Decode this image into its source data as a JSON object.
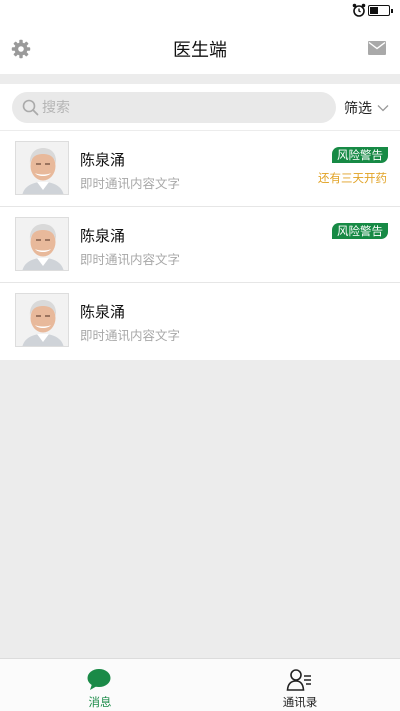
{
  "header": {
    "title": "医生端"
  },
  "search": {
    "placeholder": "搜索",
    "filter_label": "筛选"
  },
  "conversations": [
    {
      "name": "陈泉涌",
      "preview": "即时通讯内容文字",
      "badge": "风险警告",
      "note": "还有三天开药"
    },
    {
      "name": "陈泉涌",
      "preview": "即时通讯内容文字",
      "badge": "风险警告",
      "note": ""
    },
    {
      "name": "陈泉涌",
      "preview": "即时通讯内容文字",
      "badge": "",
      "note": ""
    }
  ],
  "tabs": [
    {
      "label": "消息",
      "icon": "chat-bubble-icon",
      "active": true
    },
    {
      "label": "通讯录",
      "icon": "contacts-icon",
      "active": false
    }
  ],
  "colors": {
    "accent": "#1a8a47",
    "badge": "#178a45",
    "note": "#e1a224"
  }
}
